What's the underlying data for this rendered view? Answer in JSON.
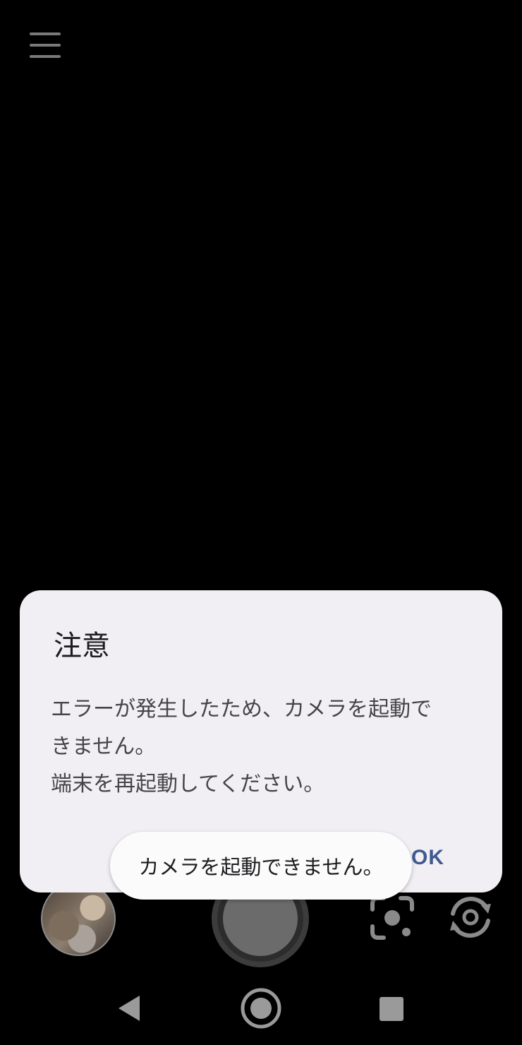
{
  "toolbar": {
    "menu_icon": "hamburger-menu-icon"
  },
  "controls": {
    "gallery_thumbnail": "last-photo-thumbnail",
    "shutter_icon": "shutter-button",
    "lens_icon": "google-lens-icon",
    "switch_icon": "switch-camera-icon"
  },
  "navbar": {
    "back_icon": "back-icon",
    "home_icon": "home-icon",
    "recents_icon": "recents-icon"
  },
  "dialog": {
    "title": "注意",
    "message": "エラーが発生したため、カメラを起動で\nきません。\n端末を再起動してください。",
    "ok_label": "OK"
  },
  "toast": {
    "message": "カメラを起動できません。"
  },
  "colors": {
    "background": "#000000",
    "dialog_bg": "#f1eff3",
    "accent": "#3f5a91"
  }
}
